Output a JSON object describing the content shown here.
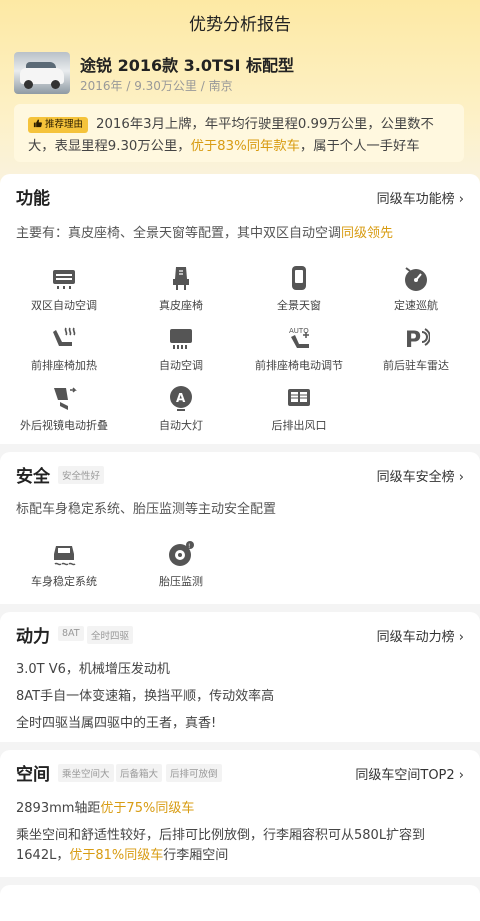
{
  "page_title": "优势分析报告",
  "car": {
    "name": "途锐 2016款 3.0TSI 标配型",
    "meta": "2016年 / 9.30万公里 / 南京"
  },
  "reason": {
    "badge": "推荐理由",
    "text_before": "2016年3月上牌，年平均行驶里程0.99万公里，公里数不大，表显里程9.30万公里，",
    "highlight": "优于83%同年款车",
    "text_after": "，属于个人一手好车"
  },
  "features": {
    "title": "功能",
    "rank": "同级车功能榜 ›",
    "desc_before": "主要有：真皮座椅、全景天窗等配置，其中双区自动空调",
    "desc_highlight": "同级领先",
    "items": [
      {
        "label": "双区自动空调",
        "icon": "dual-zone-ac-icon"
      },
      {
        "label": "真皮座椅",
        "icon": "leather-seat-icon"
      },
      {
        "label": "全景天窗",
        "icon": "panoramic-sunroof-icon"
      },
      {
        "label": "定速巡航",
        "icon": "cruise-control-icon"
      },
      {
        "label": "前排座椅加热",
        "icon": "seat-heating-icon"
      },
      {
        "label": "自动空调",
        "icon": "auto-ac-icon"
      },
      {
        "label": "前排座椅电动调节",
        "icon": "power-seat-icon"
      },
      {
        "label": "前后驻车雷达",
        "icon": "parking-radar-icon"
      },
      {
        "label": "外后视镜电动折叠",
        "icon": "mirror-fold-icon"
      },
      {
        "label": "自动大灯",
        "icon": "auto-headlight-icon"
      },
      {
        "label": "后排出风口",
        "icon": "rear-vent-icon"
      }
    ]
  },
  "safety": {
    "title": "安全",
    "tag": "安全性好",
    "rank": "同级车安全榜 ›",
    "desc": "标配车身稳定系统、胎压监测等主动安全配置",
    "items": [
      {
        "label": "车身稳定系统",
        "icon": "stability-control-icon"
      },
      {
        "label": "胎压监测",
        "icon": "tire-pressure-icon"
      }
    ]
  },
  "power": {
    "title": "动力",
    "tags": [
      "8AT",
      "全时四驱"
    ],
    "rank": "同级车动力榜 ›",
    "lines": [
      "3.0T V6，机械增压发动机",
      "8AT手自一体变速箱，换挡平顺，传动效率高",
      "全时四驱当属四驱中的王者，真香!"
    ]
  },
  "space": {
    "title": "空间",
    "tags": [
      "乘坐空间大",
      "后备箱大",
      "后排可放倒"
    ],
    "rank": "同级车空间TOP2 ›",
    "line1_before": "2893mm轴距",
    "line1_highlight": "优于75%同级车",
    "line2": "乘坐空间和舒适性较好，后排可比例放倒，行李厢容积可从580L扩容到",
    "line3_before": "1642L，",
    "line3_highlight": "优于81%同级车",
    "line3_after": "行李厢空间"
  }
}
